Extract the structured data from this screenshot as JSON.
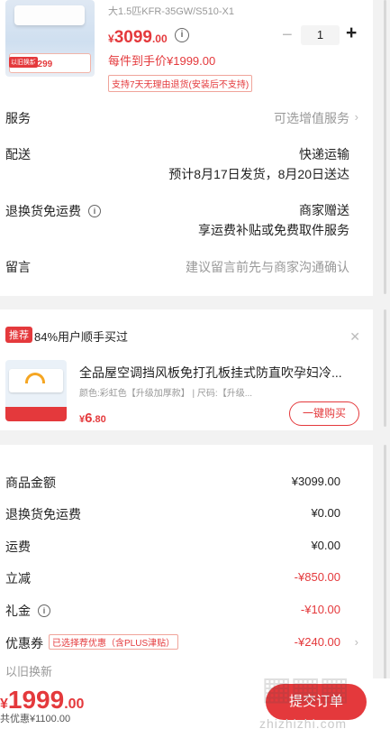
{
  "product": {
    "sku_text": "大1.5匹KFR-35GW/S510-X1",
    "thumb_badge": "以旧换新",
    "thumb_price": "2299",
    "price_yen": "¥",
    "price_int": "3099",
    "price_dec": ".00",
    "quantity": "1",
    "final_price": "每件到手价¥1999.00",
    "return_policy": "支持7天无理由退货(安装后不支持)"
  },
  "rows": {
    "service_label": "服务",
    "service_value": "可选增值服务",
    "delivery_label": "配送",
    "delivery_value": "快递运输",
    "delivery_date": "预计8月17日发货，8月20日送达",
    "return_label": "退换货免运费",
    "return_value_1": "商家赠送",
    "return_value_2": "享运费补贴或免费取件服务",
    "message_label": "留言",
    "message_placeholder": "建议留言前先与商家沟通确认"
  },
  "recommend": {
    "tag": "推荐",
    "title": "84%用户顺手买过",
    "name": "全品屋空调挡风板免打孔板挂式防直吹孕妇冷...",
    "spec": "颜色:彩虹色【升级加厚款】 | 尺码:【升级...",
    "price_yen": "¥",
    "price_int": "6",
    "price_dec": ".80",
    "buy_label": "一键购买"
  },
  "summary": {
    "goods_label": "商品金额",
    "goods_value": "¥3099.00",
    "return_label": "退换货免运费",
    "return_value": "¥0.00",
    "freight_label": "运费",
    "freight_value": "¥0.00",
    "discount_label": "立减",
    "discount_value": "-¥850.00",
    "gift_label": "礼金",
    "gift_value": "-¥10.00",
    "coupon_label": "优惠券",
    "coupon_tag": "已选择荐优惠（含PLUS津贴）",
    "coupon_value": "-¥240.00",
    "partial_label": "以旧换新"
  },
  "bottom": {
    "total_yen": "¥",
    "total_int": "1999",
    "total_dec": ".00",
    "saving": "共优惠¥1100.00",
    "submit_label": "提交订单",
    "watermark": "zhizhizhi.com"
  },
  "colors": {
    "accent": "#e4393c"
  }
}
